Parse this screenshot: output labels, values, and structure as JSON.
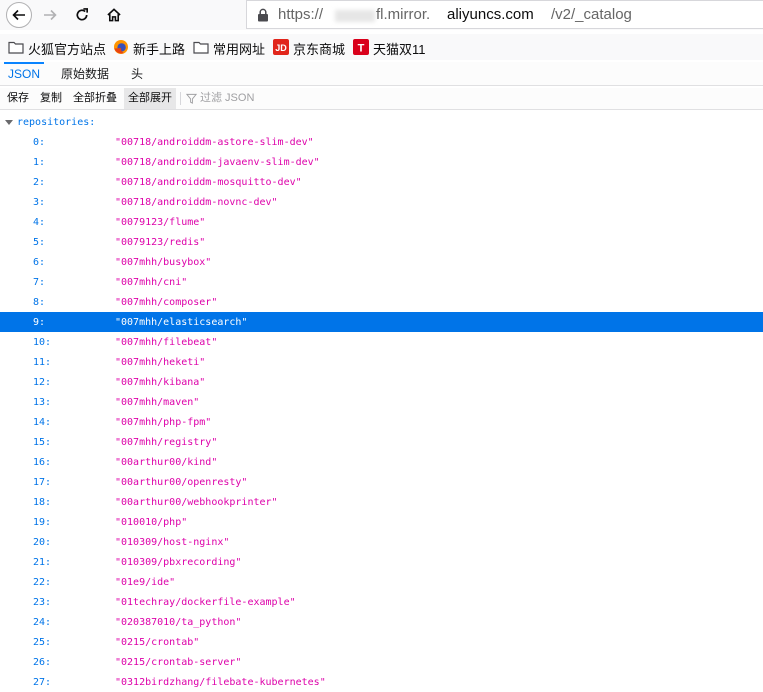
{
  "browser": {
    "url_scheme": "https://",
    "url_subdomain_tail": "fl.mirror.",
    "url_domain": "aliyuncs.com",
    "url_path": "/v2/_catalog"
  },
  "bookmarks": [
    {
      "label": "火狐官方站点",
      "icon": "folder-icon"
    },
    {
      "label": "新手上路",
      "icon": "firefox-icon"
    },
    {
      "label": "常用网址",
      "icon": "folder-icon"
    },
    {
      "label": "京东商城",
      "icon": "jd-icon",
      "icon_text": "JD"
    },
    {
      "label": "天猫双11",
      "icon": "tmall-icon",
      "icon_text": "T"
    }
  ],
  "tabs": [
    {
      "label": "JSON",
      "selected": true
    },
    {
      "label": "原始数据",
      "selected": false
    },
    {
      "label": "头",
      "selected": false
    }
  ],
  "toolbar": {
    "save": "保存",
    "copy": "复制",
    "collapse_all": "全部折叠",
    "expand_all": "全部展开",
    "filter_placeholder": "过滤 JSON"
  },
  "tree": {
    "root_key": "repositories:",
    "selected_index": 9,
    "rows": [
      {
        "key": "0:",
        "value": "\"00718/androiddm-astore-slim-dev\""
      },
      {
        "key": "1:",
        "value": "\"00718/androiddm-javaenv-slim-dev\""
      },
      {
        "key": "2:",
        "value": "\"00718/androiddm-mosquitto-dev\""
      },
      {
        "key": "3:",
        "value": "\"00718/androiddm-novnc-dev\""
      },
      {
        "key": "4:",
        "value": "\"0079123/flume\""
      },
      {
        "key": "5:",
        "value": "\"0079123/redis\""
      },
      {
        "key": "6:",
        "value": "\"007mhh/busybox\""
      },
      {
        "key": "7:",
        "value": "\"007mhh/cni\""
      },
      {
        "key": "8:",
        "value": "\"007mhh/composer\""
      },
      {
        "key": "9:",
        "value": "\"007mhh/elasticsearch\""
      },
      {
        "key": "10:",
        "value": "\"007mhh/filebeat\""
      },
      {
        "key": "11:",
        "value": "\"007mhh/heketi\""
      },
      {
        "key": "12:",
        "value": "\"007mhh/kibana\""
      },
      {
        "key": "13:",
        "value": "\"007mhh/maven\""
      },
      {
        "key": "14:",
        "value": "\"007mhh/php-fpm\""
      },
      {
        "key": "15:",
        "value": "\"007mhh/registry\""
      },
      {
        "key": "16:",
        "value": "\"00arthur00/kind\""
      },
      {
        "key": "17:",
        "value": "\"00arthur00/openresty\""
      },
      {
        "key": "18:",
        "value": "\"00arthur00/webhookprinter\""
      },
      {
        "key": "19:",
        "value": "\"010010/php\""
      },
      {
        "key": "20:",
        "value": "\"010309/host-nginx\""
      },
      {
        "key": "21:",
        "value": "\"010309/pbxrecording\""
      },
      {
        "key": "22:",
        "value": "\"01e9/ide\""
      },
      {
        "key": "23:",
        "value": "\"01techray/dockerfile-example\""
      },
      {
        "key": "24:",
        "value": "\"020387010/ta_python\""
      },
      {
        "key": "25:",
        "value": "\"0215/crontab\""
      },
      {
        "key": "26:",
        "value": "\"0215/crontab-server\""
      },
      {
        "key": "27:",
        "value": "\"0312birdzhang/filebate-kubernetes\""
      }
    ]
  },
  "colors": {
    "key": "#0074e8",
    "string": "#dd00a9",
    "selection": "#0074e8"
  }
}
